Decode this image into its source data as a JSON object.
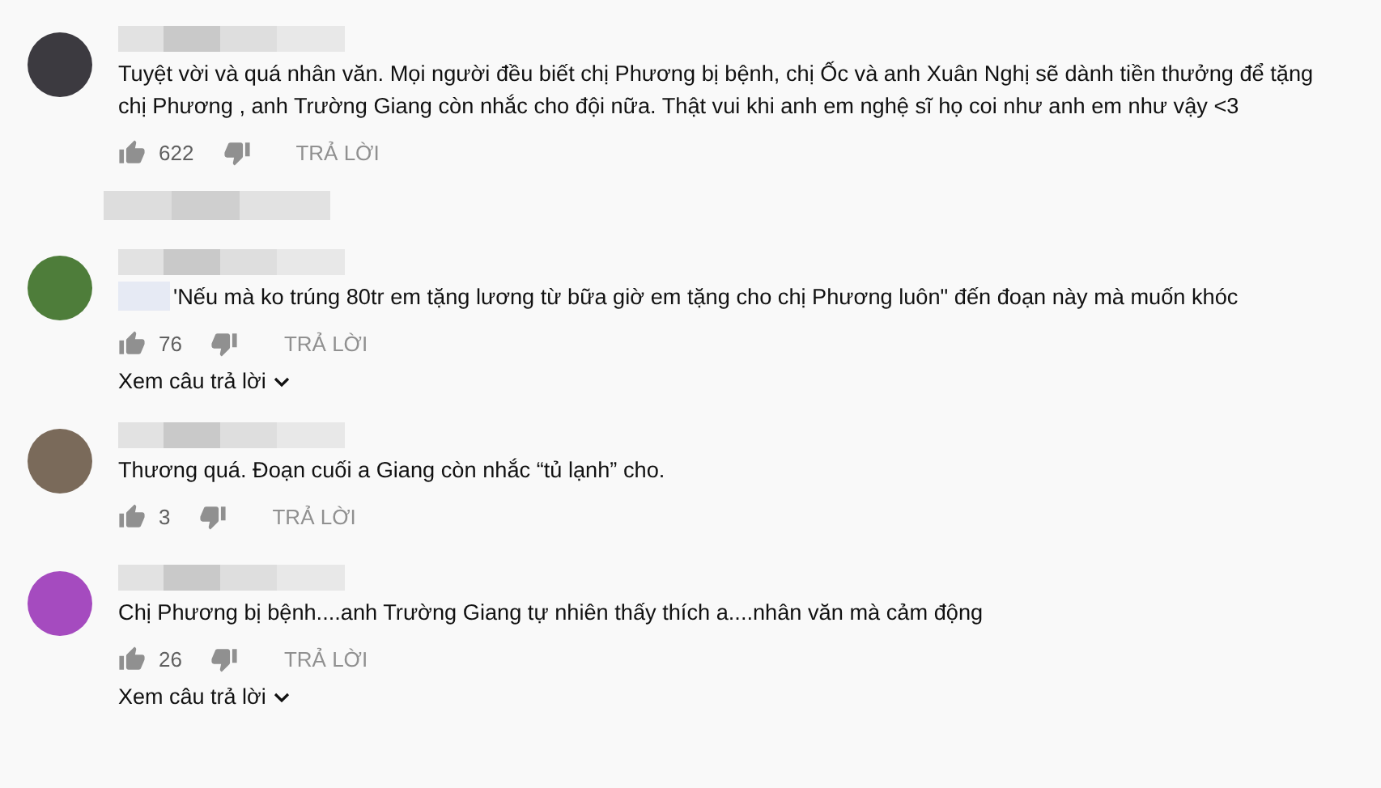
{
  "comments": [
    {
      "color": "#3c3a40",
      "text": "Tuyệt vời và quá nhân văn. Mọi người đều biết chị Phương bị bệnh, chị Ốc và anh Xuân Nghị sẽ dành tiền thưởng để tặng chị Phương , anh Trường Giang còn nhắc cho đội nữa. Thật vui khi anh em nghệ sĩ họ coi như anh em như vậy <3",
      "text_prefix_blurred": false,
      "likes": "622",
      "reply": "TRẢ LỜI",
      "blurred_footer": true
    },
    {
      "color": "#4e7d3a",
      "text": "'Nếu mà ko trúng 80tr em tặng lương từ bữa giờ em tặng cho chị Phương luôn\" đến đoạn này mà muốn khóc",
      "text_prefix_blurred": true,
      "likes": "76",
      "reply": "TRẢ LỜI",
      "blurred_footer": false,
      "view_replies": "Xem câu trả lời"
    },
    {
      "color": "#7a6a5a",
      "text": "Thương quá. Đoạn cuối a Giang còn nhắc “tủ lạnh” cho.",
      "text_prefix_blurred": false,
      "likes": "3",
      "reply": "TRẢ LỜI",
      "blurred_footer": false
    },
    {
      "color": "#a54bbf",
      "text": "Chị Phương bị bệnh....anh Trường Giang tự nhiên thấy thích a....nhân văn mà cảm động",
      "text_prefix_blurred": false,
      "likes": "26",
      "reply": "TRẢ LỜI",
      "blurred_footer": false,
      "view_replies": "Xem câu trả lời"
    }
  ]
}
